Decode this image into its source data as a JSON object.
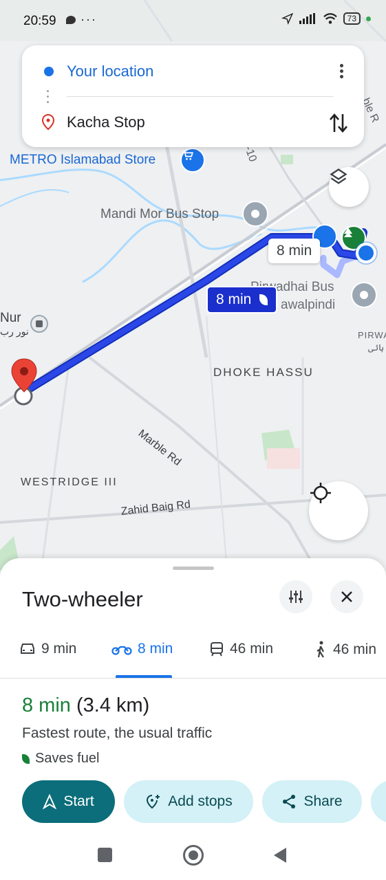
{
  "status_bar": {
    "time": "20:59",
    "battery": "73"
  },
  "search": {
    "origin": "Your location",
    "destination": "Kacha Stop"
  },
  "map": {
    "labels": {
      "metro_store": "METRO Islamabad Store",
      "mandi_mor": "Mandi Mor Bus Stop",
      "pirwadhai_1": "Pirwadhai Bus",
      "pirwadhai_2": "awalpindi",
      "nur": "Nur",
      "nur_urdu": "نور رب",
      "dhoke_hassu": "DHOKE HASSU",
      "marble_rd": "Marble Rd",
      "westridge": "WESTRIDGE III",
      "zahid_baig": "Zahid Baig Rd",
      "pirwa": "PIRWA",
      "pirwa_urdu": "ہائی",
      "road_10": "-10",
      "ble_r": "ble R"
    },
    "route_time_primary": "8 min",
    "route_time_alt": "8 min"
  },
  "sheet": {
    "title": "Two-wheeler",
    "modes": [
      {
        "icon": "car-icon",
        "time": "9 min"
      },
      {
        "icon": "motorcycle-icon",
        "time": "8 min"
      },
      {
        "icon": "transit-icon",
        "time": "46 min"
      },
      {
        "icon": "walk-icon",
        "time": "46 min"
      }
    ],
    "summary_time": "8 min",
    "summary_distance": "(3.4 km)",
    "description": "Fastest route, the usual traffic",
    "fuel": "Saves fuel",
    "actions": {
      "start": "Start",
      "add_stops": "Add stops",
      "share": "Share"
    }
  },
  "colors": {
    "route": "#1a35d4",
    "accent": "#1a73e8",
    "start_button": "#0b6e7a",
    "chip": "#d3f1f6",
    "eta_green": "#188038"
  }
}
